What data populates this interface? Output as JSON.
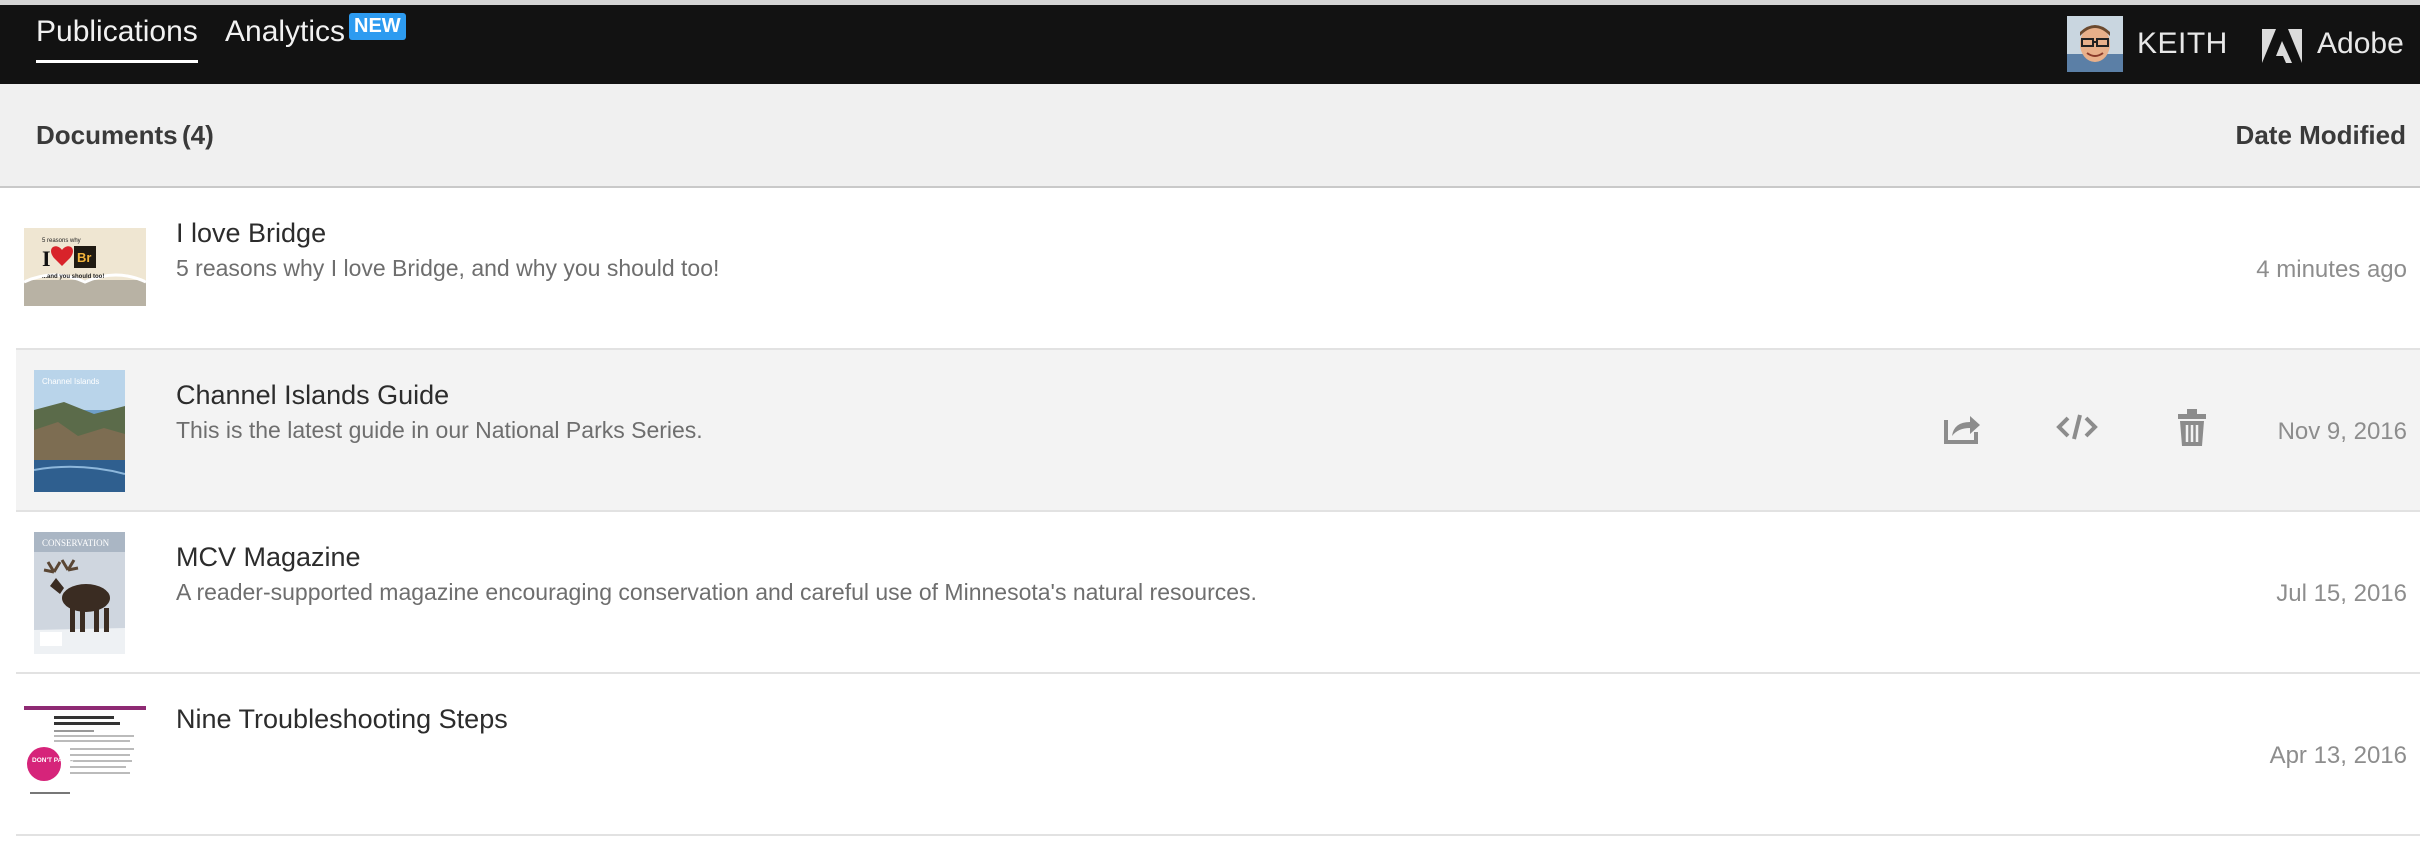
{
  "topbar": {
    "tabs": [
      {
        "label": "Publications",
        "active": true
      },
      {
        "label": "Analytics",
        "badge": "NEW"
      }
    ],
    "user": {
      "name": "KEITH",
      "avatar_icon": "user-avatar"
    },
    "brand": {
      "label": "Adobe",
      "icon": "adobe-logo-icon"
    }
  },
  "documents": {
    "title": "Documents",
    "count": "(4)",
    "sort_label": "Date Modified",
    "rows": [
      {
        "title": "I love Bridge",
        "description": "5 reasons why I love Bridge, and why you should too!",
        "date": "4 minutes ago",
        "thumb": {
          "line1": "5 reasons why",
          "badge": "Br",
          "line2": "...and you should too!"
        }
      },
      {
        "title": "Channel Islands Guide",
        "description": "This is the latest guide in our National Parks Series.",
        "date": "Nov 9, 2016",
        "thumb": {
          "caption": "Channel Islands"
        },
        "actions": [
          {
            "icon": "share-icon"
          },
          {
            "icon": "embed-code-icon"
          },
          {
            "icon": "trash-icon"
          }
        ]
      },
      {
        "title": "MCV Magazine",
        "description": "A reader-supported magazine encouraging conservation and careful use of Minnesota's natural resources.",
        "date": "Jul 15, 2016",
        "thumb": {
          "caption": "CONSERVATION"
        }
      },
      {
        "title": "Nine Troubleshooting Steps",
        "description": "",
        "date": "Apr 13, 2016",
        "thumb": {
          "badge": "DON'T PANIC"
        }
      }
    ]
  },
  "colors": {
    "topbar_bg": "#121212",
    "header_bg": "#f0f0f0",
    "hover_row_bg": "#f3f3f3",
    "badge_blue": "#2d9bf0",
    "pink_accent": "#d6247a"
  }
}
